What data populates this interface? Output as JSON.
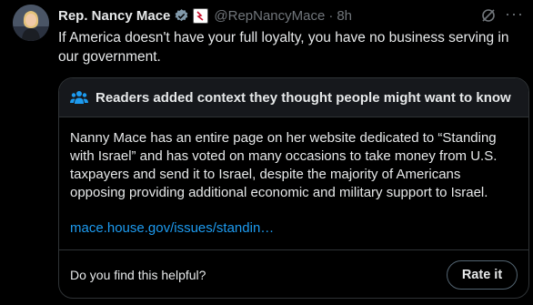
{
  "tweet": {
    "author_name": "Rep. Nancy Mace",
    "handle": "@RepNancyMace",
    "separator": "·",
    "time": "8h",
    "text": "If America doesn't have your full loyalty, you have no business serving in our government.",
    "more_glyph": "···"
  },
  "community_note": {
    "heading": "Readers added context they thought people might want to know",
    "body": "Nanny Mace has an entire page on her website dedicated to “Standing with Israel” and has voted on many occasions to take money from U.S. taxpayers and send it to Israel, despite the majority of Americans opposing providing additional economic and military support to Israel.",
    "link": "mace.house.gov/issues/standin…",
    "helpful_prompt": "Do you find this helpful?",
    "rate_label": "Rate it"
  },
  "colors": {
    "background": "#000000",
    "text": "#e7e9ea",
    "muted": "#71767b",
    "link": "#1d9bf0",
    "verified_badge": "#829aab",
    "border": "#2f3336"
  },
  "icons": [
    "avatar",
    "verified-badge-icon",
    "affiliation-badge-icon",
    "grok-icon",
    "more-icon",
    "users-icon"
  ]
}
